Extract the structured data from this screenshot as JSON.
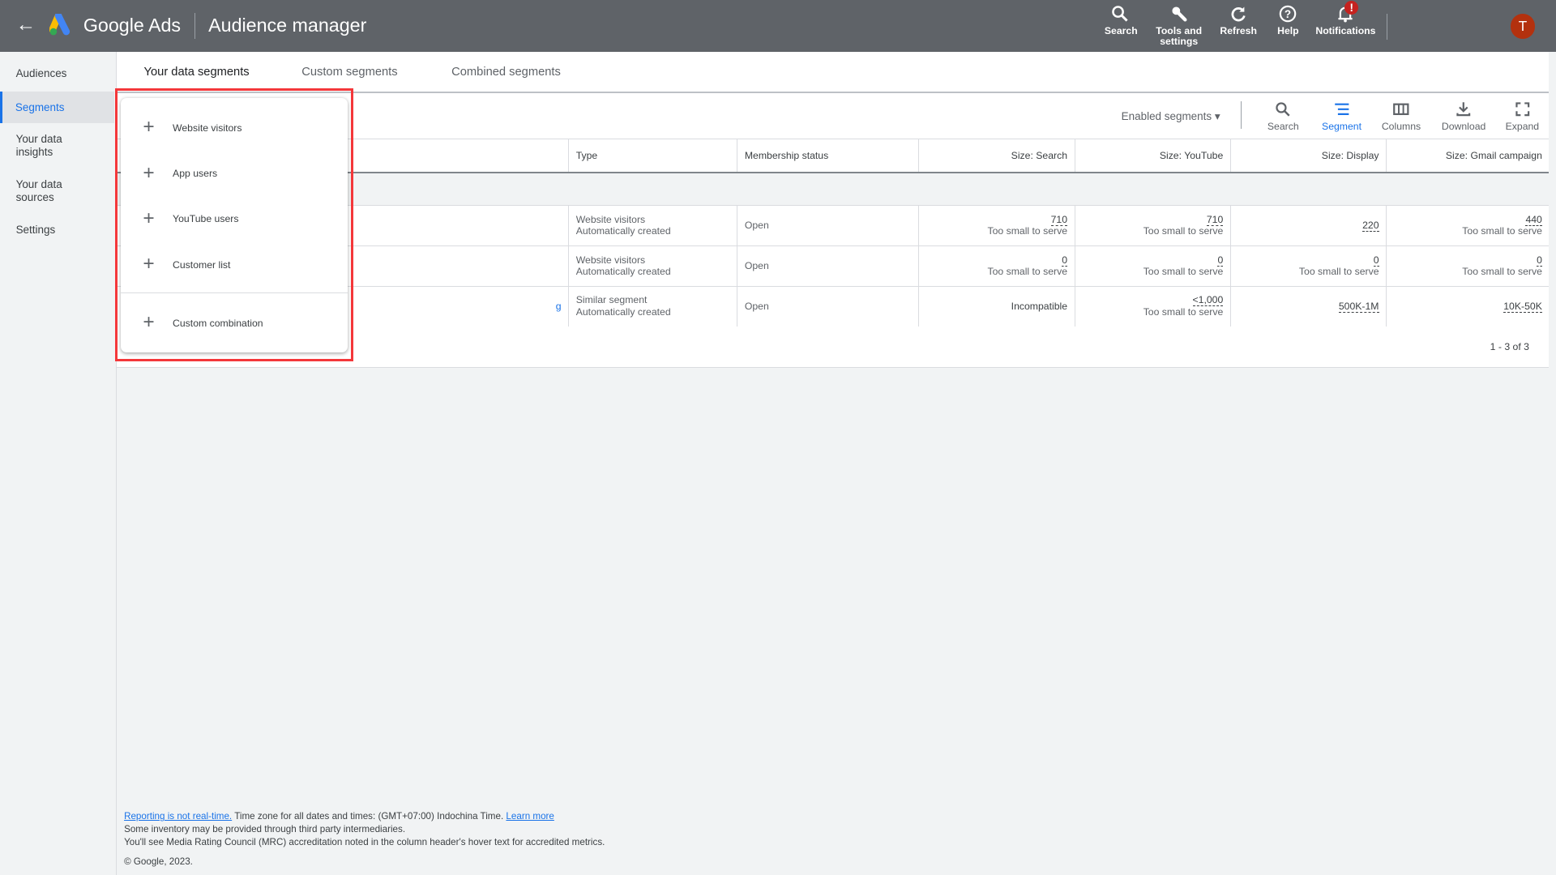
{
  "header": {
    "back": "←",
    "brand": "Google Ads",
    "title": "Audience manager",
    "buttons": [
      {
        "label": "Search",
        "icon": "search-icon"
      },
      {
        "label": "Tools and settings",
        "icon": "wrench-icon"
      },
      {
        "label": "Refresh",
        "icon": "refresh-icon"
      },
      {
        "label": "Help",
        "icon": "help-icon"
      },
      {
        "label": "Notifications",
        "icon": "bell-icon",
        "badge": "!"
      }
    ],
    "avatar": "T",
    "avatar_color": "#b3310e"
  },
  "sidebar": {
    "items": [
      {
        "label": "Audiences"
      },
      {
        "label": "Segments",
        "active": true
      },
      {
        "label": "Your data insights"
      },
      {
        "label": "Your data sources"
      },
      {
        "label": "Settings"
      }
    ]
  },
  "tabs": [
    {
      "label": "Your data segments",
      "active": true
    },
    {
      "label": "Custom segments"
    },
    {
      "label": "Combined segments"
    }
  ],
  "toolbar": {
    "filter": "Enabled segments",
    "tools": [
      {
        "label": "Search",
        "icon": "search-icon"
      },
      {
        "label": "Segment",
        "icon": "segment-icon",
        "active": true
      },
      {
        "label": "Columns",
        "icon": "columns-icon"
      },
      {
        "label": "Download",
        "icon": "download-icon"
      },
      {
        "label": "Expand",
        "icon": "expand-icon"
      }
    ]
  },
  "table": {
    "headers": [
      "",
      "Type",
      "Membership status",
      "Size: Search",
      "Size: YouTube",
      "Size: Display",
      "Size: Gmail campaign"
    ],
    "rows": [
      {
        "name": "",
        "type": "Website visitors",
        "type_sub": "Automatically created",
        "status": "Open",
        "search": "710",
        "search_sub": "Too small to serve",
        "youtube": "710",
        "youtube_sub": "Too small to serve",
        "display": "220",
        "display_sub": "",
        "gmail": "440",
        "gmail_sub": "Too small to serve"
      },
      {
        "name": "",
        "type": "Website visitors",
        "type_sub": "Automatically created",
        "status": "Open",
        "search": "0",
        "search_sub": "Too small to serve",
        "youtube": "0",
        "youtube_sub": "Too small to serve",
        "display": "0",
        "display_sub": "Too small to serve",
        "gmail": "0",
        "gmail_sub": "Too small to serve"
      },
      {
        "name": "g",
        "type": "Similar segment",
        "type_sub": "Automatically created",
        "status": "Open",
        "search": "Incompatible",
        "search_sub": "",
        "youtube": "<1,000",
        "youtube_sub": "Too small to serve",
        "display": "500K-1M",
        "display_sub": "",
        "gmail": "10K-50K",
        "gmail_sub": ""
      }
    ],
    "pagination": "1 - 3 of 3"
  },
  "menu": {
    "items": [
      {
        "label": "Website visitors"
      },
      {
        "label": "App users"
      },
      {
        "label": "YouTube users"
      },
      {
        "label": "Customer list"
      },
      {
        "label": "Custom combination"
      }
    ],
    "plus": "+",
    "highlight_color": "#f4373a"
  },
  "footer": {
    "link1": "Reporting is not real-time.",
    "text1": " Time zone for all dates and times: (GMT+07:00) Indochina Time. ",
    "link2": "Learn more",
    "line2": "Some inventory may be provided through third party intermediaries.",
    "line3": "You'll see Media Rating Council (MRC) accreditation noted in the column header's hover text for accredited metrics.",
    "copyright": "© Google, 2023."
  }
}
